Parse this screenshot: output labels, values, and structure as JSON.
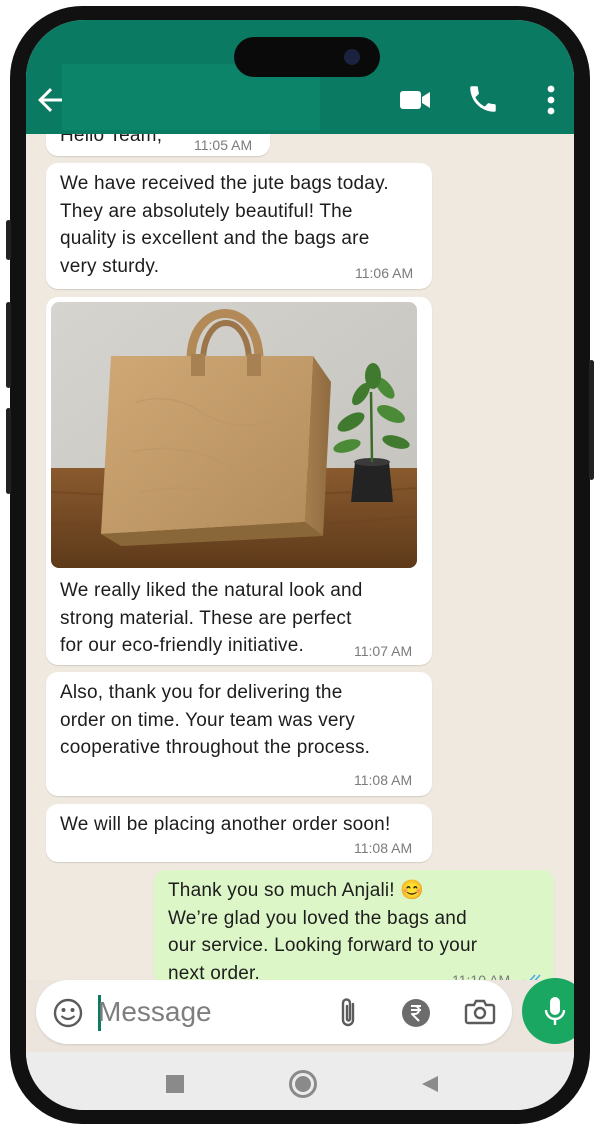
{
  "header": {
    "contact_name": "",
    "back_icon": "back-arrow-icon",
    "video_icon": "video-call-icon",
    "call_icon": "phone-call-icon",
    "menu_icon": "more-vertical-icon",
    "color": "#0b7a62"
  },
  "messages": [
    {
      "text": "Hello Team,",
      "time": "11:05 AM"
    },
    {
      "text": "We have received the jute bags today.\nThey are absolutely beautiful! The\nquality is excellent and the bags are\nvery sturdy.",
      "time": "11:06 AM"
    },
    {
      "text": "We really liked the natural look and\nstrong material. These are perfect\nfor our eco-friendly initiative.",
      "time": "11:07 AM",
      "image": "jute-bag-photo"
    },
    {
      "text": "Also, thank you for delivering the\norder on time. Your team was very\ncooperative throughout the process.",
      "time": "11:08 AM"
    },
    {
      "text": "We will be placing another order soon!",
      "time": "11:08 AM"
    },
    {
      "text": "Thank you so much Anjali! 😊\nWe’re glad you loved the bags and\nour service. Looking forward to your\nnext order.",
      "time": "11:10 AM",
      "outgoing": true,
      "status": "read-double-tick-icon"
    }
  ],
  "composer": {
    "placeholder": "Message",
    "emoji_icon": "emoji-icon",
    "attach_icon": "paperclip-icon",
    "payment_icon": "rupee-icon",
    "camera_icon": "camera-icon",
    "mic_icon": "microphone-icon"
  },
  "navigation": {
    "recents_icon": "square-icon",
    "home_icon": "circle-icon",
    "back_icon": "triangle-back-icon"
  }
}
